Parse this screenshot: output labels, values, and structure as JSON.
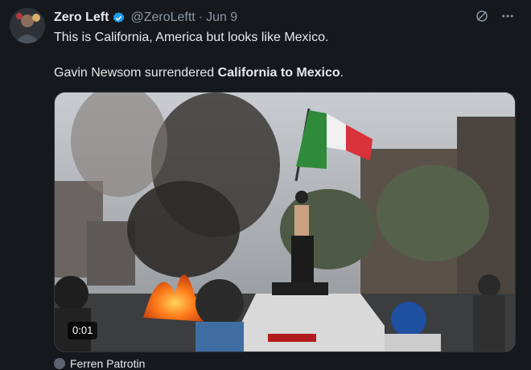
{
  "tweet": {
    "author_name": "Zero Left",
    "handle": "@ZeroLeftt",
    "separator": "·",
    "date": "Jun 9",
    "line1": "This is California, America but looks like Mexico.",
    "line2_prefix": "Gavin Newsom surrendered ",
    "line2_bold": "California to Mexico",
    "line2_suffix": ".",
    "icons": [
      "verified-badge-icon",
      "grok-icon",
      "more-icon"
    ]
  },
  "media": {
    "duration": "0:01",
    "description_icons": [
      "video-player"
    ]
  },
  "quoted": {
    "name_partial": "Ferren Patrotin"
  },
  "colors": {
    "verified_blue": "#1d9bf0",
    "background": "#15181c",
    "secondary_text": "#8b98a5"
  }
}
